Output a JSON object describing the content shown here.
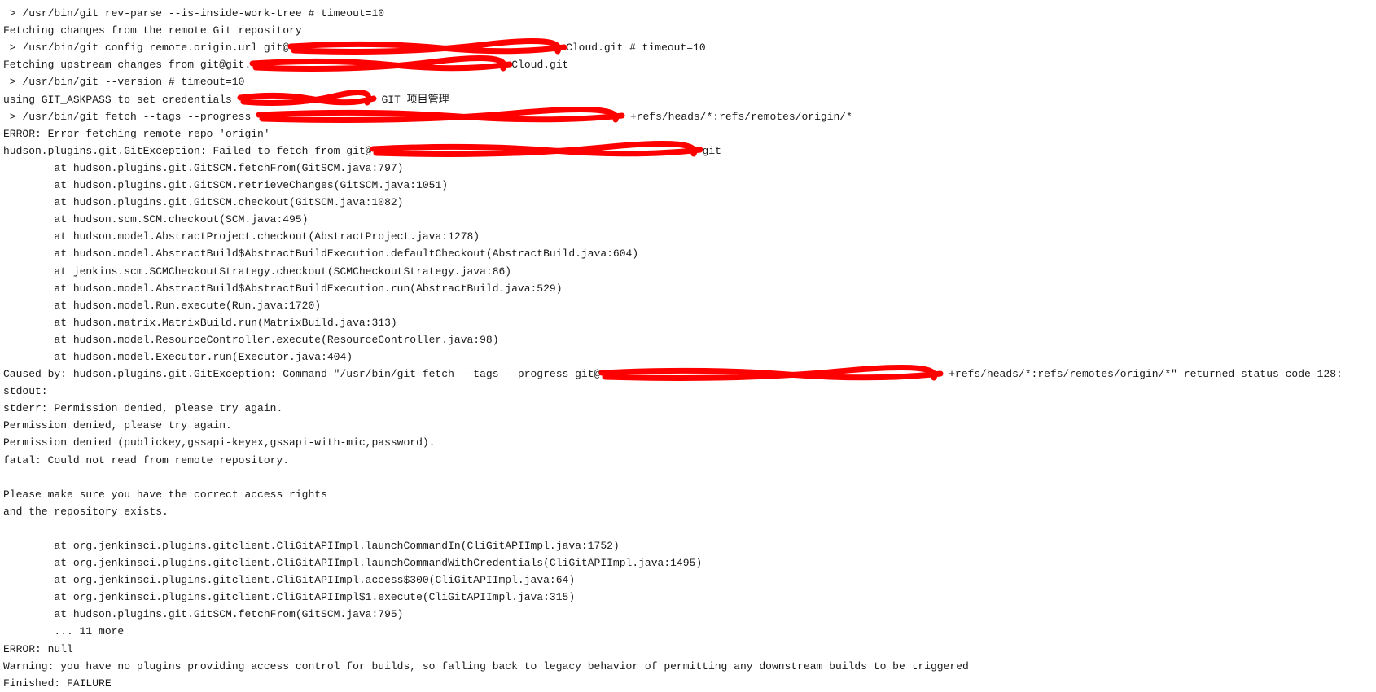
{
  "console": {
    "redaction_color": "#ff0000",
    "lines": [
      {
        "pre": ""
      },
      {
        "pre": " > /usr/bin/git rev-parse --is-inside-work-tree # timeout=10"
      },
      {
        "pre": "Fetching changes from the remote Git repository"
      },
      {
        "pre": " > /usr/bin/git config remote.origin.url git@",
        "redacted": true,
        "post": "Cloud.git # timeout=10"
      },
      {
        "pre": "Fetching upstream changes from git@git.",
        "redacted": true,
        "post": "Cloud.git"
      },
      {
        "pre": " > /usr/bin/git --version # timeout=10"
      },
      {
        "pre": "using GIT_ASKPASS to set credentials ",
        "redacted": true,
        "post": " GIT 项目管理"
      },
      {
        "pre": " > /usr/bin/git fetch --tags --progress ",
        "redacted": true,
        "post": " +refs/heads/*:refs/remotes/origin/*"
      },
      {
        "pre": "ERROR: Error fetching remote repo 'origin'"
      },
      {
        "pre": "hudson.plugins.git.GitException: Failed to fetch from git@",
        "redacted": true,
        "post": "git"
      },
      {
        "pre": "        at hudson.plugins.git.GitSCM.fetchFrom(GitSCM.java:797)"
      },
      {
        "pre": "        at hudson.plugins.git.GitSCM.retrieveChanges(GitSCM.java:1051)"
      },
      {
        "pre": "        at hudson.plugins.git.GitSCM.checkout(GitSCM.java:1082)"
      },
      {
        "pre": "        at hudson.scm.SCM.checkout(SCM.java:495)"
      },
      {
        "pre": "        at hudson.model.AbstractProject.checkout(AbstractProject.java:1278)"
      },
      {
        "pre": "        at hudson.model.AbstractBuild$AbstractBuildExecution.defaultCheckout(AbstractBuild.java:604)"
      },
      {
        "pre": "        at jenkins.scm.SCMCheckoutStrategy.checkout(SCMCheckoutStrategy.java:86)"
      },
      {
        "pre": "        at hudson.model.AbstractBuild$AbstractBuildExecution.run(AbstractBuild.java:529)"
      },
      {
        "pre": "        at hudson.model.Run.execute(Run.java:1720)"
      },
      {
        "pre": "        at hudson.matrix.MatrixBuild.run(MatrixBuild.java:313)"
      },
      {
        "pre": "        at hudson.model.ResourceController.execute(ResourceController.java:98)"
      },
      {
        "pre": "        at hudson.model.Executor.run(Executor.java:404)"
      },
      {
        "pre": "Caused by: hudson.plugins.git.GitException: Command \"/usr/bin/git fetch --tags --progress git@",
        "redacted": true,
        "post": " +refs/heads/*:refs/remotes/origin/*\" returned status code 128:"
      },
      {
        "pre": "stdout:"
      },
      {
        "pre": "stderr: Permission denied, please try again."
      },
      {
        "pre": "Permission denied, please try again."
      },
      {
        "pre": "Permission denied (publickey,gssapi-keyex,gssapi-with-mic,password)."
      },
      {
        "pre": "fatal: Could not read from remote repository."
      },
      {
        "pre": ""
      },
      {
        "pre": "Please make sure you have the correct access rights"
      },
      {
        "pre": "and the repository exists."
      },
      {
        "pre": ""
      },
      {
        "pre": "        at org.jenkinsci.plugins.gitclient.CliGitAPIImpl.launchCommandIn(CliGitAPIImpl.java:1752)"
      },
      {
        "pre": "        at org.jenkinsci.plugins.gitclient.CliGitAPIImpl.launchCommandWithCredentials(CliGitAPIImpl.java:1495)"
      },
      {
        "pre": "        at org.jenkinsci.plugins.gitclient.CliGitAPIImpl.access$300(CliGitAPIImpl.java:64)"
      },
      {
        "pre": "        at org.jenkinsci.plugins.gitclient.CliGitAPIImpl$1.execute(CliGitAPIImpl.java:315)"
      },
      {
        "pre": "        at hudson.plugins.git.GitSCM.fetchFrom(GitSCM.java:795)"
      },
      {
        "pre": "        ... 11 more"
      },
      {
        "pre": "ERROR: null"
      },
      {
        "pre": "Warning: you have no plugins providing access control for builds, so falling back to legacy behavior of permitting any downstream builds to be triggered"
      },
      {
        "pre": "Finished: FAILURE"
      }
    ]
  }
}
